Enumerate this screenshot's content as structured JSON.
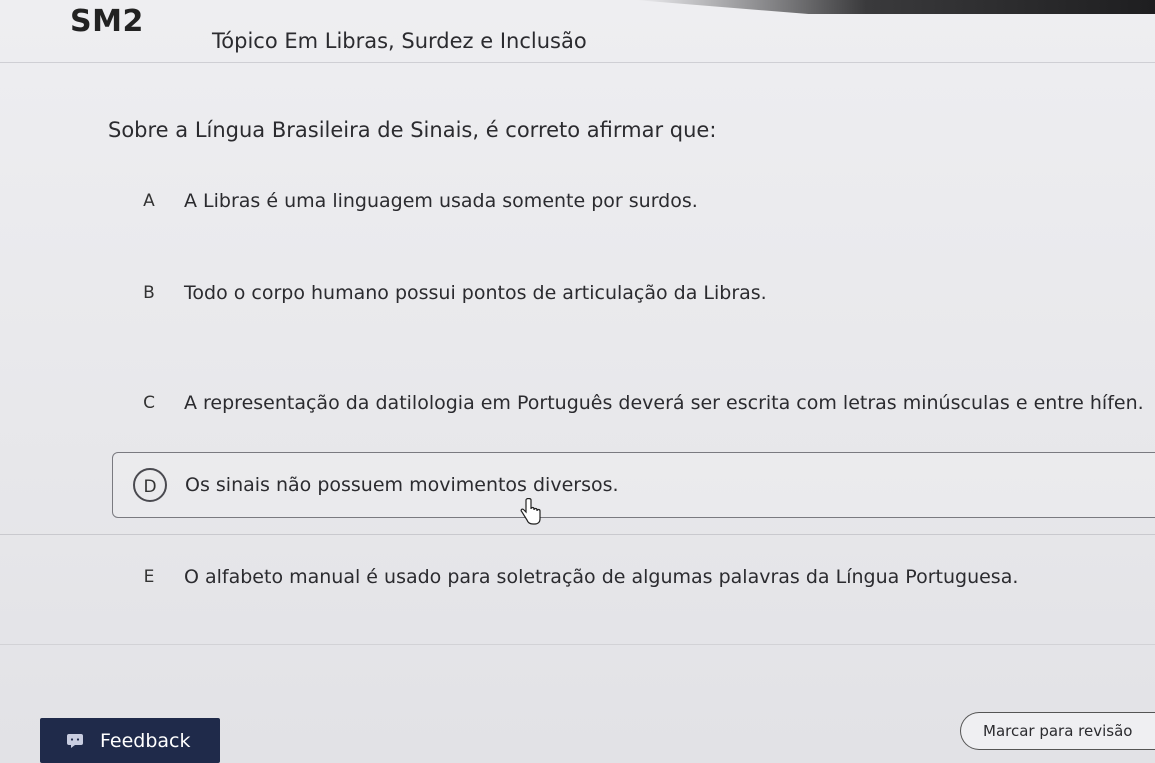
{
  "header": {
    "subject_code": "SM2",
    "topic_title": "Tópico Em Libras, Surdez e Inclusão"
  },
  "question": {
    "text": "Sobre a Língua Brasileira de Sinais, é correto afirmar que:"
  },
  "options": [
    {
      "letter": "A",
      "text": "A Libras é uma linguagem usada somente por surdos.",
      "selected": false
    },
    {
      "letter": "B",
      "text": "Todo o corpo humano possui pontos de articulação da Libras.",
      "selected": false
    },
    {
      "letter": "C",
      "text": "A representação da datilologia em Português deverá ser escrita com letras minúsculas e entre hífen.",
      "selected": false
    },
    {
      "letter": "D",
      "text": "Os sinais não possuem movimentos diversos.",
      "selected": true
    },
    {
      "letter": "E",
      "text": "O alfabeto manual é usado para soletração de algumas palavras da Língua Portuguesa.",
      "selected": false
    }
  ],
  "footer": {
    "feedback_label": "Feedback",
    "feedback_icon": "chat-icon",
    "review_label": "Marcar para revisão"
  },
  "colors": {
    "feedback_bg": "#1f2a4a",
    "page_bg": "#e9e9ec"
  }
}
